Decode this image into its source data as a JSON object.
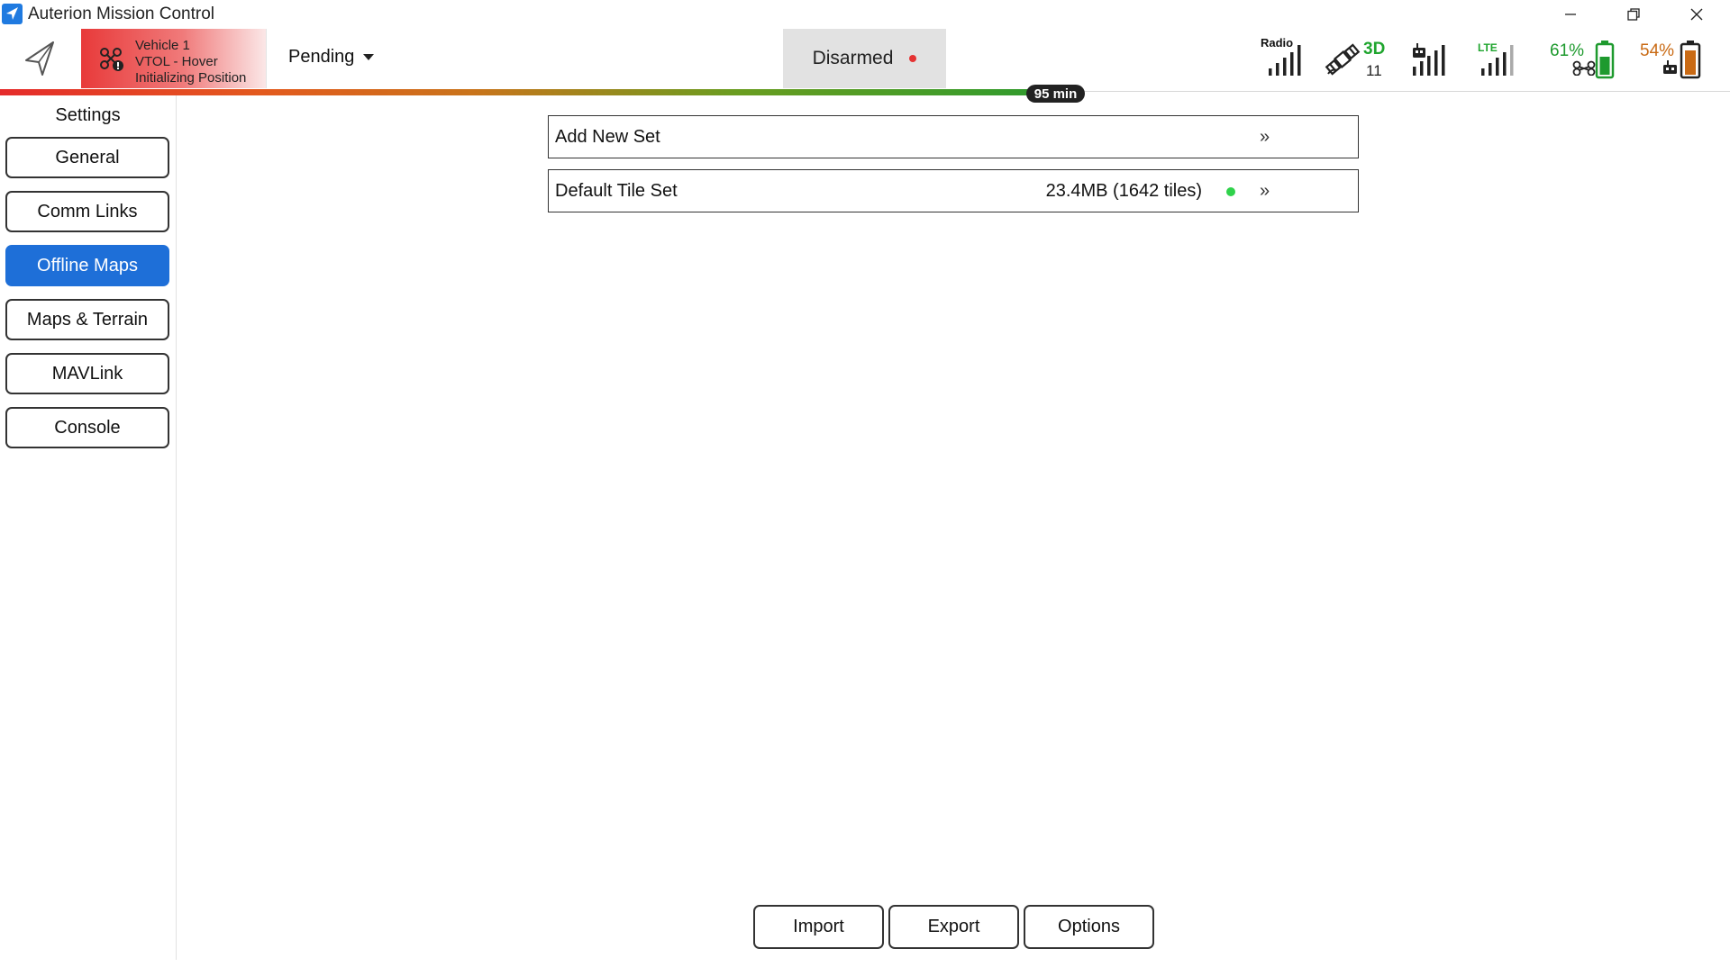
{
  "window": {
    "title": "Auterion Mission Control"
  },
  "vehicle": {
    "name": "Vehicle 1",
    "mode": "VTOL - Hover",
    "status": "Initializing Position"
  },
  "flight_mode": "Pending",
  "arm_state": "Disarmed",
  "flight_time_remaining": "95 min",
  "indicators": {
    "radio_label": "Radio",
    "gps_fix": "3D",
    "gps_satellites": "11",
    "lte_label": "LTE",
    "vehicle_battery": "61%",
    "controller_battery": "54%"
  },
  "colors": {
    "accent": "#1e6fd8",
    "vehicle_panel_red": "#e83a3a",
    "gps_green": "#1fa52e",
    "battery_green": "#1e9a2e",
    "battery_orange": "#c96a14",
    "status_green": "#2fd24b",
    "arm_dot_red": "#e53333"
  },
  "sidebar": {
    "title": "Settings",
    "items": [
      {
        "label": "General"
      },
      {
        "label": "Comm Links"
      },
      {
        "label": "Offline Maps",
        "active": true
      },
      {
        "label": "Maps & Terrain"
      },
      {
        "label": "MAVLink"
      },
      {
        "label": "Console"
      }
    ]
  },
  "tile_sets": [
    {
      "name": "Add New Set",
      "info": "",
      "arrow": "»"
    },
    {
      "name": "Default Tile Set",
      "info": "23.4MB (1642 tiles)",
      "arrow": "»",
      "status": "green"
    }
  ],
  "actions": {
    "import": "Import",
    "export": "Export",
    "options": "Options"
  }
}
